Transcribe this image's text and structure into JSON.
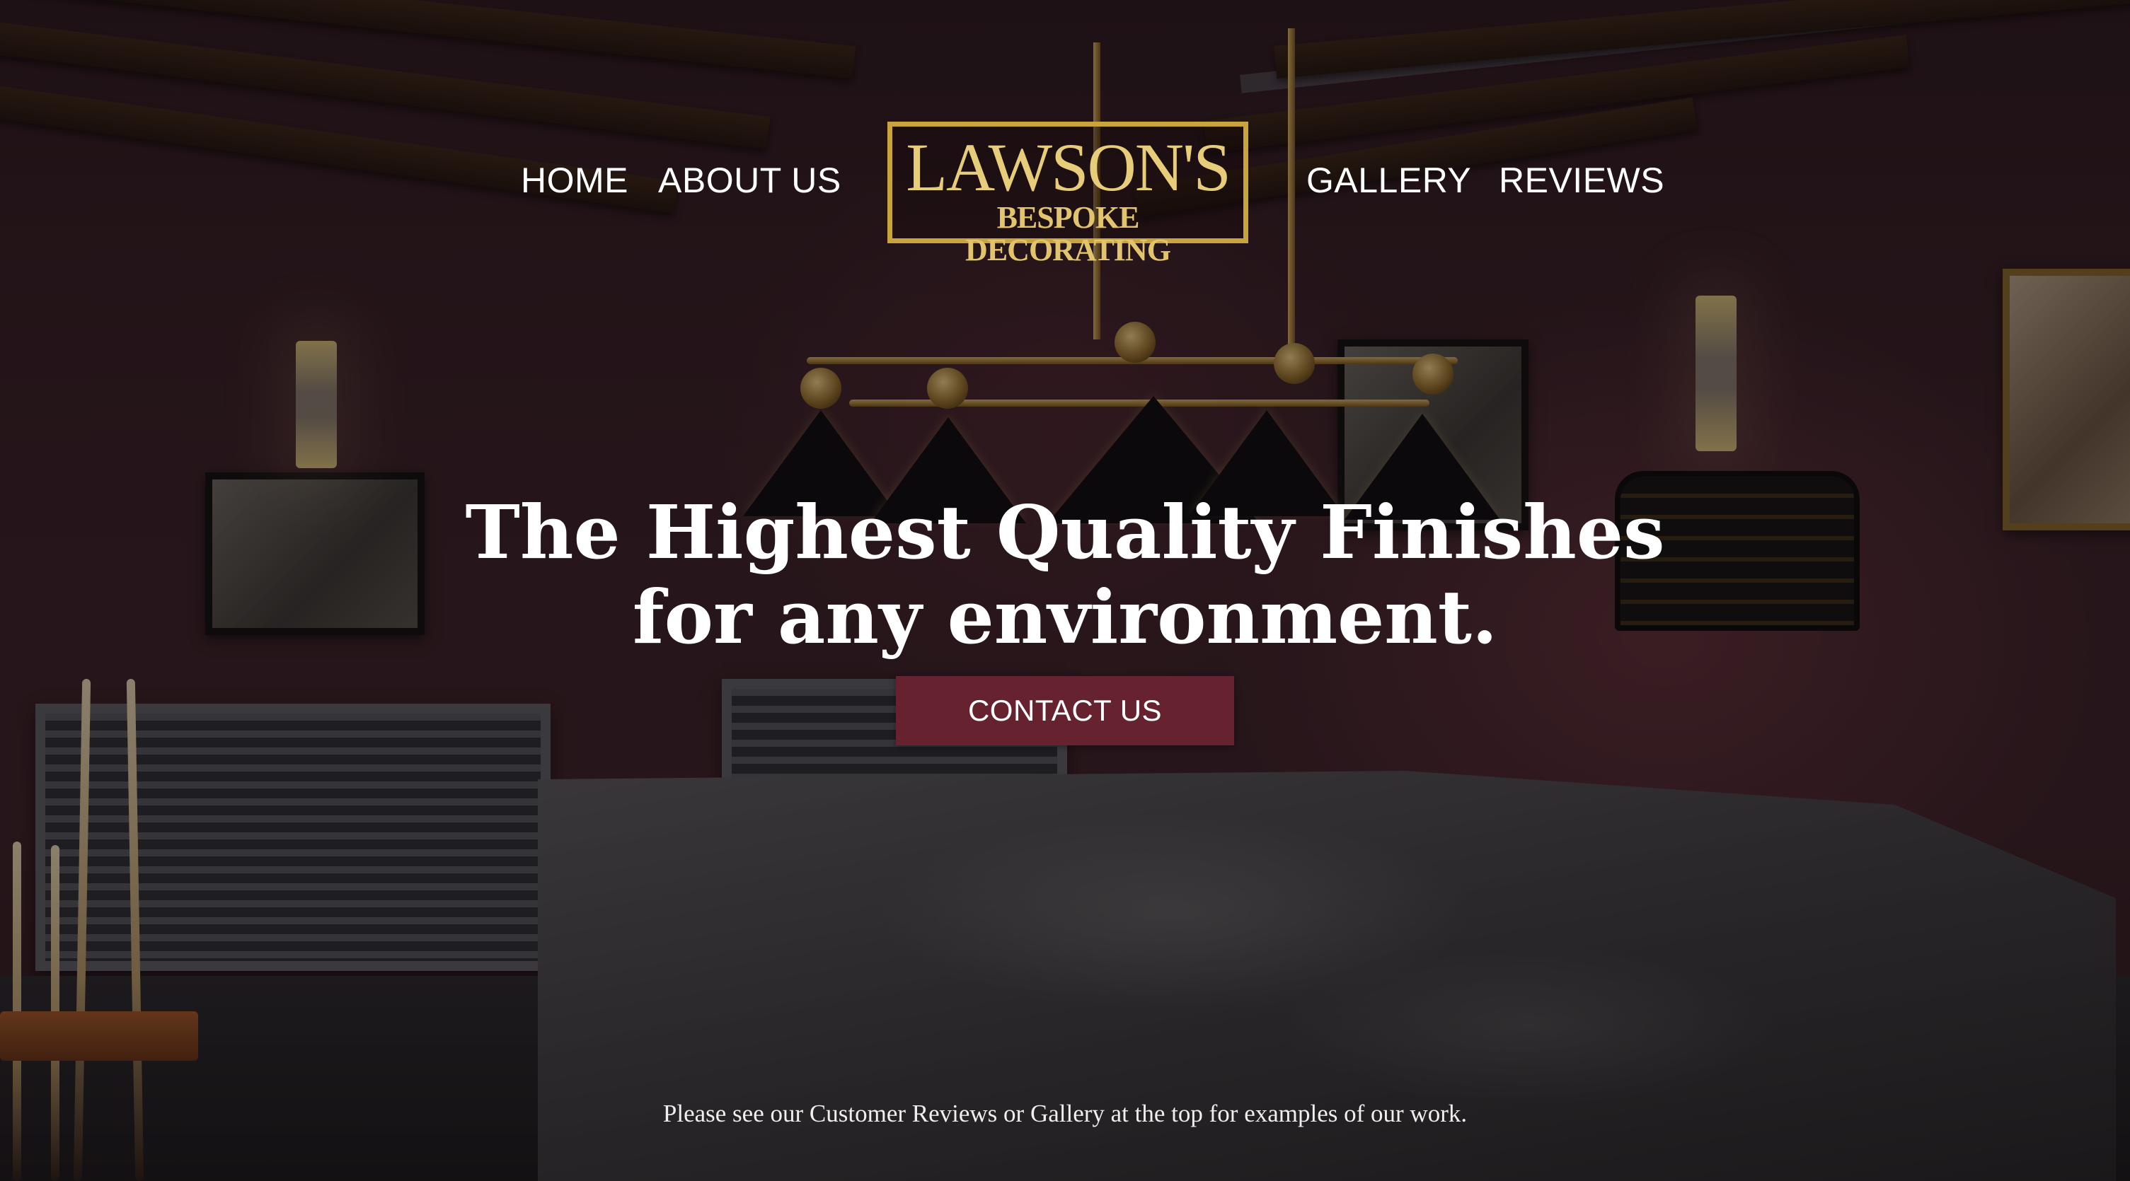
{
  "nav": {
    "left": [
      {
        "label": "HOME"
      },
      {
        "label": "ABOUT US"
      }
    ],
    "right": [
      {
        "label": "GALLERY"
      },
      {
        "label": "REVIEWS"
      }
    ]
  },
  "logo": {
    "line1": "LAWSON'S",
    "line2": "BESPOKE DECORATING",
    "accent_color": "#c9a43c"
  },
  "hero": {
    "headline_line1": "The Highest Quality Finishes",
    "headline_line2": "for any environment.",
    "cta_label": "CONTACT US",
    "cta_color": "#66222e",
    "footnote": "Please see our Customer Reviews or Gallery at the top for examples of our work."
  }
}
